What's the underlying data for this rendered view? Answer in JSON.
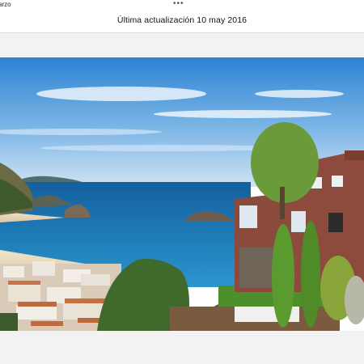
{
  "header": {
    "corner_text": "arzo",
    "more_icon": "ellipsis-icon",
    "title": "Última actualización 10 may 2016"
  },
  "photo": {
    "colors": {
      "sky_top": "#2f86d6",
      "sky_bottom": "#b9d9f3",
      "sea": "#1e7fbf",
      "house": "#8b4a3e",
      "tree": "#4f7d35"
    }
  }
}
